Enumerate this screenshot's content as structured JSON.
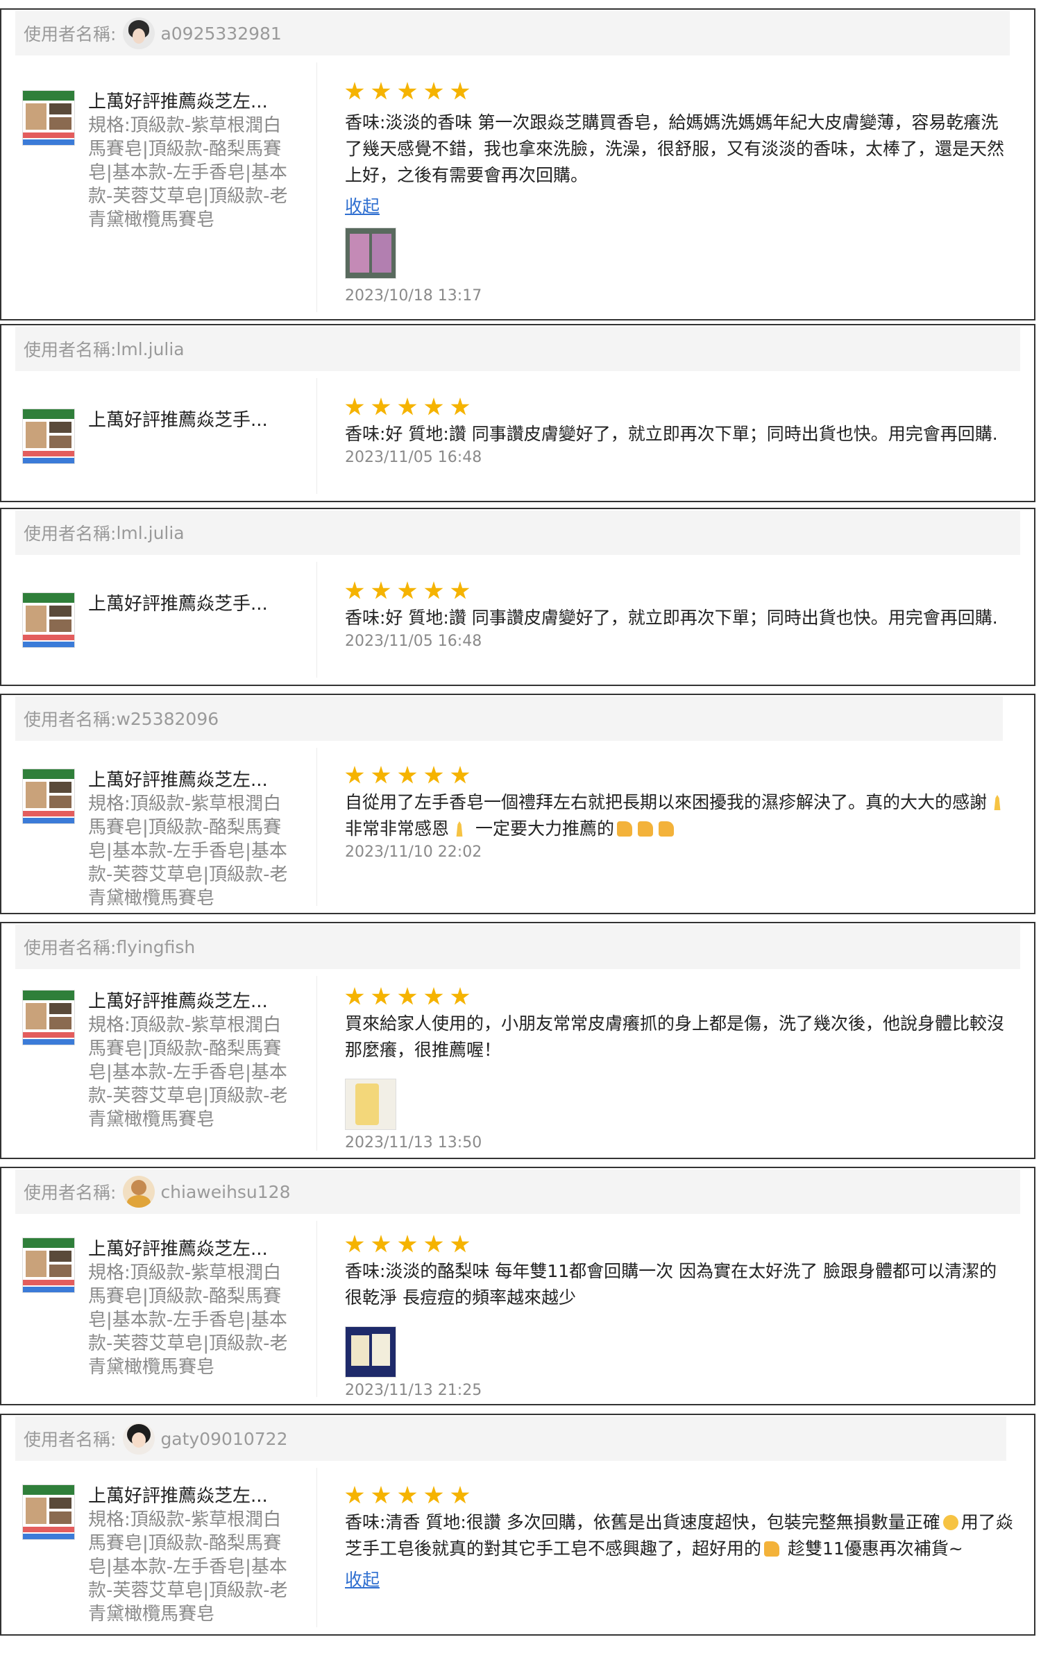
{
  "username_label": "使用者名稱:",
  "collapse_label": "收起",
  "reviews": [
    {
      "username": "a0925332981",
      "avatar": "woman-avatar",
      "product_name": "上萬好評推薦焱芝左...",
      "product_spec": "規格:頂級款-紫草根潤白馬賽皂|頂級款-酪梨馬賽皂|基本款-左手香皂|基本款-芙蓉艾草皂|頂級款-老青黛橄欖馬賽皂",
      "rating": 5,
      "text": "香味:淡淡的香味 第一次跟焱芝購買香皂，給媽媽洗媽媽年紀大皮膚變薄，容易乾癢洗了幾天感覺不錯，我也拿來洗臉，洗澡，很舒服，又有淡淡的香味，太棒了，還是天然 上好，之後有需要會再次回購。",
      "has_collapse": true,
      "has_photo": true,
      "date": "2023/10/18 13:17"
    },
    {
      "username": "lml.julia",
      "avatar": "",
      "product_name": "上萬好評推薦焱芝手...",
      "product_spec": "",
      "rating": 5,
      "text": "香味:好 質地:讚 同事讚皮膚變好了，就立即再次下單；同時出貨也快。用完會再回購.",
      "has_collapse": false,
      "has_photo": false,
      "date": "2023/11/05 16:48"
    },
    {
      "username": "lml.julia",
      "avatar": "",
      "product_name": "上萬好評推薦焱芝手...",
      "product_spec": "",
      "rating": 5,
      "text": "香味:好 質地:讚 同事讚皮膚變好了，就立即再次下單；同時出貨也快。用完會再回購.",
      "has_collapse": false,
      "has_photo": false,
      "date": "2023/11/05 16:48"
    },
    {
      "username": "w25382096",
      "avatar": "",
      "product_name": "上萬好評推薦焱芝左...",
      "product_spec": "規格:頂級款-紫草根潤白馬賽皂|頂級款-酪梨馬賽皂|基本款-左手香皂|基本款-芙蓉艾草皂|頂級款-老青黛橄欖馬賽皂",
      "rating": 5,
      "text_parts": [
        "自從用了左手香皂一個禮拜左右就把長期以來困擾我的濕疹解決了。真的大大的感謝",
        " 非常非常感恩",
        " 一定要大力推薦的",
        "",
        "",
        ""
      ],
      "has_collapse": false,
      "has_photo": false,
      "date": "2023/11/10 22:02"
    },
    {
      "username": "flyingfish",
      "avatar": "",
      "product_name": "上萬好評推薦焱芝左...",
      "product_spec": "規格:頂級款-紫草根潤白馬賽皂|頂級款-酪梨馬賽皂|基本款-左手香皂|基本款-芙蓉艾草皂|頂級款-老青黛橄欖馬賽皂",
      "rating": 5,
      "text": "買來給家人使用的，小朋友常常皮膚癢抓的身上都是傷，洗了幾次後，他說身體比較沒那麼癢，很推薦喔！",
      "has_collapse": false,
      "has_photo": true,
      "date": "2023/11/13 13:50"
    },
    {
      "username": "chiaweihsu128",
      "avatar": "man-avatar",
      "product_name": "上萬好評推薦焱芝左...",
      "product_spec": "規格:頂級款-紫草根潤白馬賽皂|頂級款-酪梨馬賽皂|基本款-左手香皂|基本款-芙蓉艾草皂|頂級款-老青黛橄欖馬賽皂",
      "rating": 5,
      "text": "香味:淡淡的酪梨味 每年雙11都會回購一次 因為實在太好洗了 臉跟身體都可以清潔的很乾淨 長痘痘的頻率越來越少",
      "has_collapse": false,
      "has_photo": true,
      "date": "2023/11/13 21:25"
    },
    {
      "username": "gaty09010722",
      "avatar": "girl-avatar",
      "product_name": "上萬好評推薦焱芝左...",
      "product_spec": "規格:頂級款-紫草根潤白馬賽皂|頂級款-酪梨馬賽皂|基本款-左手香皂|基本款-芙蓉艾草皂|頂級款-老青黛橄欖馬賽皂",
      "rating": 5,
      "text_parts": [
        "香味:清香 質地:很讚 多次回購，依舊是出貨速度超快，包裝完整無損數量正確",
        "用了焱芝手工皂後就真的對其它手工皂不感興趣了，超好用的",
        " 趁雙11優惠再次補貨~"
      ],
      "has_collapse": true,
      "has_photo": false,
      "date": ""
    }
  ]
}
